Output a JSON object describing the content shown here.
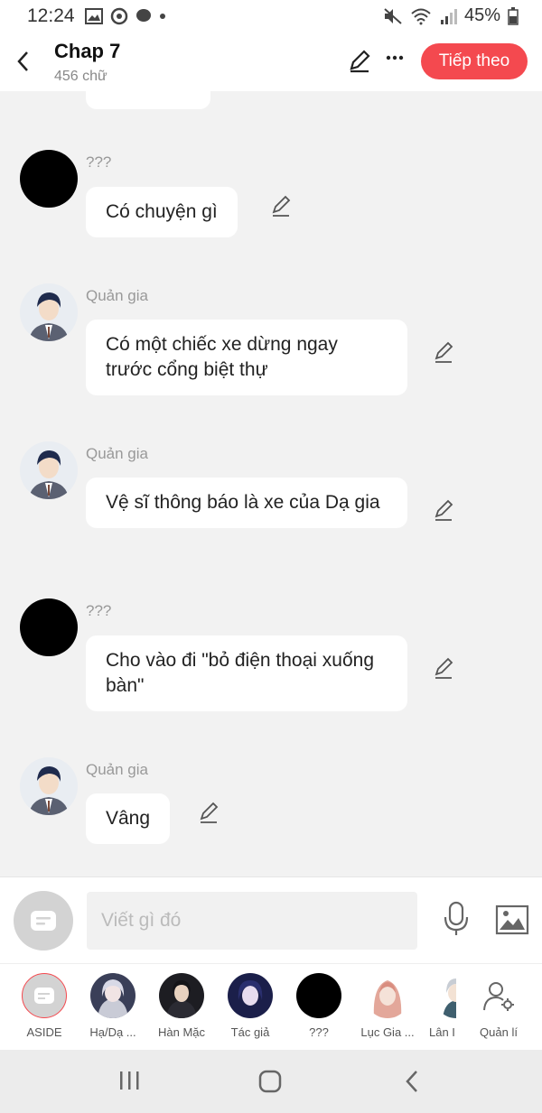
{
  "status": {
    "time": "12:24",
    "battery": "45%"
  },
  "header": {
    "title": "Chap 7",
    "subtitle": "456 chữ",
    "next_label": "Tiếp theo"
  },
  "messages": [
    {
      "speaker": "???",
      "text": "Có chuyện gì"
    },
    {
      "speaker": "Quản gia",
      "text": "Có một chiếc xe dừng ngay trước cổng biệt thự"
    },
    {
      "speaker": "Quản gia",
      "text": "Vệ sĩ thông báo là xe của Dạ gia"
    },
    {
      "speaker": "???",
      "text": "Cho vào đi \"bỏ điện thoại xuống bàn\""
    },
    {
      "speaker": "Quản gia",
      "text": "Vâng"
    }
  ],
  "input": {
    "placeholder": "Viết gì đó"
  },
  "characters": [
    {
      "label": "ASIDE"
    },
    {
      "label": "Hạ/Dạ ..."
    },
    {
      "label": "Hàn Mặc"
    },
    {
      "label": "Tác giả"
    },
    {
      "label": "???"
    },
    {
      "label": "Lục Gia ..."
    },
    {
      "label": "Lân I"
    },
    {
      "label": "Quản lí"
    }
  ],
  "colors": {
    "accent": "#f4494f",
    "background": "#f2f2f2",
    "bubble": "#ffffff"
  },
  "icons": [
    "back-icon",
    "pencil-icon",
    "more-icon",
    "mic-icon",
    "image-icon",
    "manage-user-icon"
  ]
}
